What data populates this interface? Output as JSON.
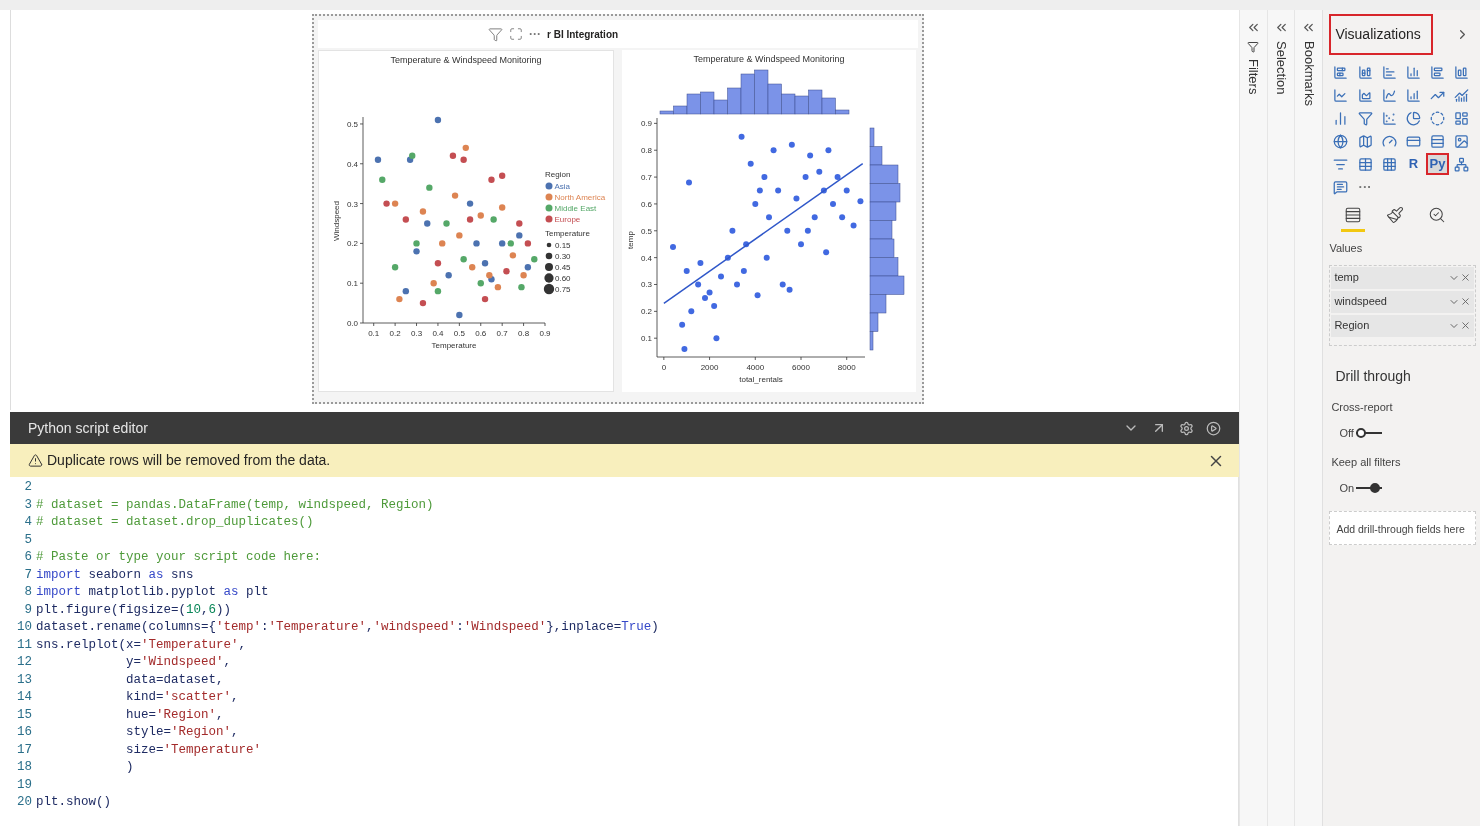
{
  "report": {
    "title_fragment": "r BI Integration",
    "more_label": "···",
    "charts": [
      {
        "legend": {
          "title": "Region"
        },
        "size_legend": {
          "title": "Temperature",
          "labels": [
            "0.15",
            "0.30",
            "0.45",
            "0.60",
            "0.75"
          ]
        },
        "chart_data": {
          "type": "scatter",
          "title": "Temperature & Windspeed Monitoring",
          "xlabel": "Temperature",
          "ylabel": "Windspeed",
          "xlim": [
            0.05,
            0.9
          ],
          "ylim": [
            0,
            0.52
          ],
          "legend": "right",
          "xticks": [
            {
              "value": 0.1,
              "label": "0.1"
            },
            {
              "value": 0.2,
              "label": "0.2"
            },
            {
              "value": 0.3,
              "label": "0.3"
            },
            {
              "value": 0.4,
              "label": "0.4"
            },
            {
              "value": 0.5,
              "label": "0.5"
            },
            {
              "value": 0.6,
              "label": "0.6"
            },
            {
              "value": 0.7,
              "label": "0.7"
            },
            {
              "value": 0.8,
              "label": "0.8"
            },
            {
              "value": 0.9,
              "label": "0.9"
            }
          ],
          "yticks": [
            {
              "value": 0,
              "label": "0.0"
            },
            {
              "value": 0.1,
              "label": "0.1"
            },
            {
              "value": 0.2,
              "label": "0.2"
            },
            {
              "value": 0.3,
              "label": "0.3"
            },
            {
              "value": 0.4,
              "label": "0.4"
            },
            {
              "value": 0.5,
              "label": "0.5"
            }
          ],
          "series": [
            {
              "name": "Asia",
              "color": "#4c72b0",
              "x": [
                0.12,
                0.27,
                0.4,
                0.5,
                0.35,
                0.62,
                0.7,
                0.78,
                0.55,
                0.45,
                0.3,
                0.65,
                0.82,
                0.25,
                0.58
              ],
              "values": [
                0.41,
                0.41,
                0.51,
                0.02,
                0.25,
                0.15,
                0.2,
                0.22,
                0.3,
                0.12,
                0.18,
                0.11,
                0.14,
                0.08,
                0.2
              ]
            },
            {
              "name": "North America",
              "color": "#dd8452",
              "x": [
                0.53,
                0.2,
                0.33,
                0.48,
                0.6,
                0.7,
                0.42,
                0.56,
                0.64,
                0.75,
                0.22,
                0.38,
                0.8,
                0.68,
                0.5
              ],
              "values": [
                0.44,
                0.3,
                0.28,
                0.32,
                0.27,
                0.29,
                0.2,
                0.14,
                0.12,
                0.17,
                0.06,
                0.1,
                0.12,
                0.09,
                0.22
              ]
            },
            {
              "name": "Middle East",
              "color": "#55a868",
              "x": [
                0.28,
                0.14,
                0.36,
                0.3,
                0.44,
                0.52,
                0.6,
                0.74,
                0.85,
                0.2,
                0.66,
                0.4,
                0.79
              ],
              "values": [
                0.42,
                0.36,
                0.34,
                0.2,
                0.25,
                0.16,
                0.1,
                0.2,
                0.16,
                0.14,
                0.26,
                0.08,
                0.09
              ]
            },
            {
              "name": "Europe",
              "color": "#c44e52",
              "x": [
                0.47,
                0.52,
                0.65,
                0.7,
                0.25,
                0.4,
                0.55,
                0.62,
                0.72,
                0.78,
                0.33,
                0.16,
                0.82
              ],
              "values": [
                0.42,
                0.41,
                0.36,
                0.37,
                0.26,
                0.15,
                0.26,
                0.06,
                0.13,
                0.25,
                0.05,
                0.3,
                0.2
              ]
            }
          ]
        }
      },
      {
        "chart_data": {
          "type": "scatter",
          "title": "Temperature & Windspeed Monitoring",
          "xlabel": "total_rentals",
          "ylabel": "temp",
          "xlim": [
            -300,
            8800
          ],
          "ylim": [
            0.03,
            0.92
          ],
          "xticks": [
            {
              "value": 0,
              "label": "0"
            },
            {
              "value": 2000,
              "label": "2000"
            },
            {
              "value": 4000,
              "label": "4000"
            },
            {
              "value": 6000,
              "label": "6000"
            },
            {
              "value": 8000,
              "label": "8000"
            }
          ],
          "yticks": [
            {
              "value": 0.1,
              "label": "0.1"
            },
            {
              "value": 0.2,
              "label": "0.2"
            },
            {
              "value": 0.3,
              "label": "0.3"
            },
            {
              "value": 0.4,
              "label": "0.4"
            },
            {
              "value": 0.5,
              "label": "0.5"
            },
            {
              "value": 0.6,
              "label": "0.6"
            },
            {
              "value": 0.7,
              "label": "0.7"
            },
            {
              "value": 0.8,
              "label": "0.8"
            },
            {
              "value": 0.9,
              "label": "0.9"
            }
          ],
          "series": [
            {
              "color": "#4169e1",
              "x": [
                400,
                1100,
                900,
                1200,
                1500,
                1800,
                2000,
                2300,
                800,
                1000,
                1600,
                2500,
                2800,
                3000,
                3200,
                3400,
                3600,
                3800,
                4000,
                4200,
                4400,
                4600,
                4800,
                5000,
                5200,
                5400,
                5600,
                5800,
                6000,
                6200,
                6400,
                6600,
                6800,
                7000,
                7200,
                7400,
                7600,
                7800,
                8000,
                8300,
                8600,
                4500,
                3500,
                2200,
                5500,
                6300,
                7100,
                4100
              ],
              "values": [
                0.44,
                0.68,
                0.06,
                0.2,
                0.3,
                0.25,
                0.27,
                0.1,
                0.15,
                0.35,
                0.38,
                0.33,
                0.4,
                0.5,
                0.3,
                0.85,
                0.45,
                0.75,
                0.6,
                0.65,
                0.7,
                0.55,
                0.8,
                0.65,
                0.3,
                0.5,
                0.82,
                0.62,
                0.45,
                0.7,
                0.78,
                0.55,
                0.72,
                0.65,
                0.8,
                0.6,
                0.7,
                0.55,
                0.65,
                0.52,
                0.61,
                0.4,
                0.35,
                0.22,
                0.28,
                0.5,
                0.42,
                0.26
              ]
            },
            {
              "type": "line",
              "color": "#2f57c9",
              "x": [
                0,
                8700
              ],
              "values": [
                0.23,
                0.75
              ]
            }
          ]
        }
      }
    ]
  },
  "editor": {
    "title": "Python script editor",
    "warning": "Duplicate rows will be removed from the data.",
    "lines": [
      {
        "number": "2"
      },
      {
        "number": "3",
        "tokens": [
          {
            "kind": "comment",
            "text": "# dataset = pandas.DataFrame(temp, windspeed, Region)"
          }
        ]
      },
      {
        "number": "4",
        "tokens": [
          {
            "kind": "comment",
            "text": "# dataset = dataset.drop_duplicates()"
          }
        ]
      },
      {
        "number": "5"
      },
      {
        "number": "6",
        "tokens": [
          {
            "kind": "comment",
            "text": "# Paste or type your script code here:"
          }
        ]
      },
      {
        "number": "7",
        "tokens": [
          {
            "kind": "keyword",
            "text": "import"
          },
          {
            "kind": "plain",
            "text": " seaborn "
          },
          {
            "kind": "keyword",
            "text": "as"
          },
          {
            "kind": "plain",
            "text": " sns"
          }
        ]
      },
      {
        "number": "8",
        "tokens": [
          {
            "kind": "keyword",
            "text": "import"
          },
          {
            "kind": "plain",
            "text": " matplotlib.pyplot "
          },
          {
            "kind": "keyword",
            "text": "as"
          },
          {
            "kind": "plain",
            "text": " plt"
          }
        ]
      },
      {
        "number": "9",
        "tokens": [
          {
            "kind": "plain",
            "text": "plt.figure(figsize=("
          },
          {
            "kind": "number",
            "text": "10"
          },
          {
            "kind": "plain",
            "text": ","
          },
          {
            "kind": "number",
            "text": "6"
          },
          {
            "kind": "plain",
            "text": "))"
          }
        ]
      },
      {
        "number": "10",
        "tokens": [
          {
            "kind": "plain",
            "text": "dataset.rename(columns={"
          },
          {
            "kind": "string",
            "text": "'temp'"
          },
          {
            "kind": "plain",
            "text": ":"
          },
          {
            "kind": "string",
            "text": "'Temperature'"
          },
          {
            "kind": "plain",
            "text": ","
          },
          {
            "kind": "string",
            "text": "'windspeed'"
          },
          {
            "kind": "plain",
            "text": ":"
          },
          {
            "kind": "string",
            "text": "'Windspeed'"
          },
          {
            "kind": "plain",
            "text": "},inplace="
          },
          {
            "kind": "keyword",
            "text": "True"
          },
          {
            "kind": "plain",
            "text": ")"
          }
        ]
      },
      {
        "number": "11",
        "tokens": [
          {
            "kind": "plain",
            "text": "sns.relplot(x="
          },
          {
            "kind": "string",
            "text": "'Temperature'"
          },
          {
            "kind": "plain",
            "text": ","
          }
        ]
      },
      {
        "number": "12",
        "tokens": [
          {
            "kind": "plain",
            "text": "            y="
          },
          {
            "kind": "string",
            "text": "'Windspeed'"
          },
          {
            "kind": "plain",
            "text": ","
          }
        ]
      },
      {
        "number": "13",
        "tokens": [
          {
            "kind": "plain",
            "text": "            data=dataset,"
          }
        ]
      },
      {
        "number": "14",
        "tokens": [
          {
            "kind": "plain",
            "text": "            kind="
          },
          {
            "kind": "string",
            "text": "'scatter'"
          },
          {
            "kind": "plain",
            "text": ","
          }
        ]
      },
      {
        "number": "15",
        "tokens": [
          {
            "kind": "plain",
            "text": "            hue="
          },
          {
            "kind": "string",
            "text": "'Region'"
          },
          {
            "kind": "plain",
            "text": ","
          }
        ]
      },
      {
        "number": "16",
        "tokens": [
          {
            "kind": "plain",
            "text": "            style="
          },
          {
            "kind": "string",
            "text": "'Region'"
          },
          {
            "kind": "plain",
            "text": ","
          }
        ]
      },
      {
        "number": "17",
        "tokens": [
          {
            "kind": "plain",
            "text": "            size="
          },
          {
            "kind": "string",
            "text": "'Temperature'"
          }
        ]
      },
      {
        "number": "18",
        "tokens": [
          {
            "kind": "plain",
            "text": "            )"
          }
        ]
      },
      {
        "number": "19"
      },
      {
        "number": "20",
        "tokens": [
          {
            "kind": "plain",
            "text": "plt.show()"
          }
        ]
      }
    ]
  },
  "side_panes": [
    {
      "label": "Filters",
      "kind": "filters"
    },
    {
      "label": "Selection",
      "kind": "plain"
    },
    {
      "label": "Bookmarks",
      "kind": "plain"
    }
  ],
  "visualizations": {
    "title": "Visualizations",
    "highlighted": true,
    "types": [
      {
        "kind": "icon",
        "selected": false
      },
      {
        "kind": "icon",
        "selected": false
      },
      {
        "kind": "icon",
        "selected": false
      },
      {
        "kind": "icon",
        "selected": false
      },
      {
        "kind": "icon",
        "selected": false
      },
      {
        "kind": "icon",
        "selected": false
      },
      {
        "kind": "icon",
        "selected": false
      },
      {
        "kind": "icon",
        "selected": false
      },
      {
        "kind": "icon",
        "selected": false
      },
      {
        "kind": "icon",
        "selected": false
      },
      {
        "kind": "icon",
        "selected": false
      },
      {
        "kind": "icon",
        "selected": false
      },
      {
        "kind": "icon",
        "selected": false
      },
      {
        "kind": "icon",
        "selected": false
      },
      {
        "kind": "icon",
        "selected": false
      },
      {
        "kind": "icon",
        "selected": false
      },
      {
        "kind": "icon",
        "selected": false
      },
      {
        "kind": "icon",
        "selected": false
      },
      {
        "kind": "icon",
        "selected": false
      },
      {
        "kind": "icon",
        "selected": false
      },
      {
        "kind": "icon",
        "selected": false
      },
      {
        "kind": "icon",
        "selected": false
      },
      {
        "kind": "icon",
        "selected": false
      },
      {
        "kind": "icon",
        "selected": false
      },
      {
        "kind": "icon",
        "selected": false
      },
      {
        "kind": "icon",
        "selected": false
      },
      {
        "kind": "icon",
        "selected": false
      },
      {
        "kind": "text",
        "label": "R",
        "selected": false
      },
      {
        "kind": "text",
        "label": "Py",
        "selected": true
      },
      {
        "kind": "icon",
        "selected": false
      },
      {
        "kind": "icon",
        "selected": false
      },
      {
        "kind": "more",
        "label": "···",
        "selected": false
      }
    ],
    "pane_tabs": [
      {
        "selected": true
      },
      {
        "selected": false
      },
      {
        "selected": false
      }
    ],
    "values_label": "Values",
    "wells": [
      "temp",
      "windspeed",
      "Region"
    ],
    "drill_title": "Drill through",
    "toggles": [
      {
        "label": "Cross-report",
        "state": "Off",
        "on": false
      },
      {
        "label": "Keep all filters",
        "state": "On",
        "on": true
      }
    ],
    "drop_hint": "Add drill-through fields here"
  }
}
